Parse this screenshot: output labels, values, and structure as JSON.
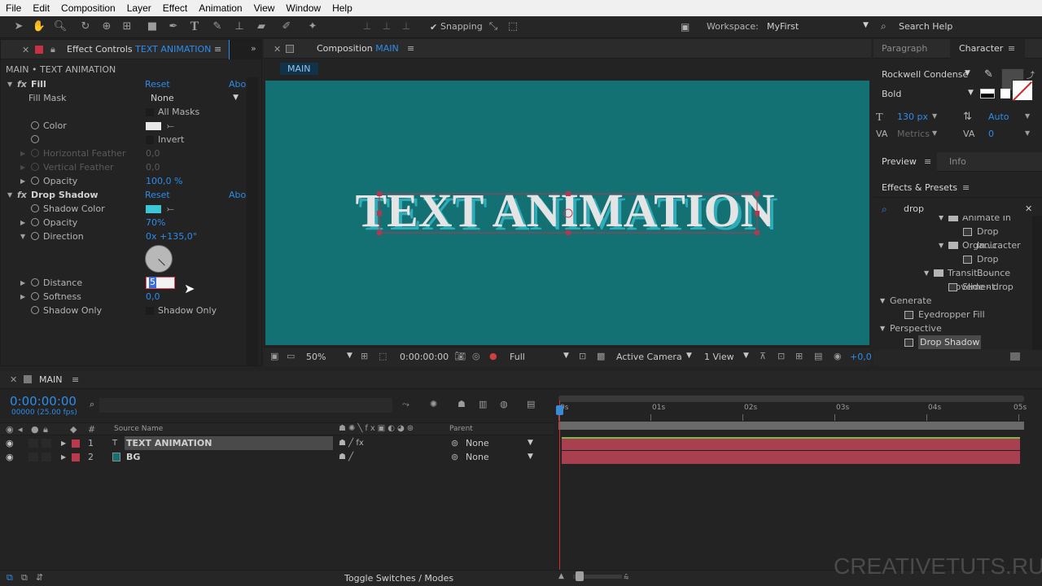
{
  "menu": [
    "File",
    "Edit",
    "Composition",
    "Layer",
    "Effect",
    "Animation",
    "View",
    "Window",
    "Help"
  ],
  "toolbar": {
    "snapping_label": "Snapping",
    "workspace_label": "Workspace:",
    "workspace_value": "MyFirst",
    "search_help": "Search Help"
  },
  "effect_controls": {
    "tab_prefix": "Effect Controls",
    "tab_layer": "TEXT ANIMATION",
    "breadcrumb": "MAIN • TEXT ANIMATION",
    "reset": "Reset",
    "about": "Abo",
    "fill": {
      "name": "Fill",
      "fill_mask_label": "Fill Mask",
      "fill_mask_value": "None",
      "all_masks": "All Masks",
      "color_label": "Color",
      "invert": "Invert",
      "h_feather_label": "Horizontal Feather",
      "h_feather_value": "0,0",
      "v_feather_label": "Vertical Feather",
      "v_feather_value": "0,0",
      "opacity_label": "Opacity",
      "opacity_value": "100,0 %"
    },
    "drop_shadow": {
      "name": "Drop Shadow",
      "shadow_color_label": "Shadow Color",
      "opacity_label": "Opacity",
      "opacity_value": "70%",
      "direction_label": "Direction",
      "direction_value": "0x +135,0°",
      "distance_label": "Distance",
      "distance_value": "5",
      "softness_label": "Softness",
      "softness_value": "0,0",
      "shadow_only_label": "Shadow Only",
      "shadow_only_checkbox": "Shadow Only"
    }
  },
  "composition": {
    "tab_prefix": "Composition",
    "tab_name": "MAIN",
    "comp_chip": "MAIN",
    "canvas_text": "TEXT ANIMATION",
    "zoom": "50%",
    "timecode": "0:00:00:00",
    "resolution": "Full",
    "camera": "Active Camera",
    "views": "1 View",
    "exposure": "+0,0"
  },
  "right_panels": {
    "paragraph_tab": "Paragraph",
    "character_tab": "Character",
    "font": "Rockwell Condense",
    "style": "Bold",
    "size": "130 px",
    "leading": "Auto",
    "kerning": "Metrics",
    "tracking": "0",
    "preview_tab": "Preview",
    "info_tab": "Info",
    "effects_tab": "Effects & Presets",
    "search_value": "drop",
    "tree": [
      {
        "label": "Animate In",
        "indent": 4,
        "type": "folder-open"
      },
      {
        "label": "Drop In...racter",
        "indent": 5,
        "type": "preset"
      },
      {
        "label": "Organic",
        "indent": 4,
        "type": "folder-open"
      },
      {
        "label": "Drop Bounce",
        "indent": 5,
        "type": "preset"
      },
      {
        "label": "Transit... - Movement",
        "indent": 3,
        "type": "folder-open"
      },
      {
        "label": "Slide - drop",
        "indent": 4,
        "type": "preset"
      },
      {
        "label": "Generate",
        "indent": 0,
        "type": "category"
      },
      {
        "label": "Eyedropper Fill",
        "indent": 1,
        "type": "effect"
      },
      {
        "label": "Perspective",
        "indent": 0,
        "type": "category"
      },
      {
        "label": "Drop Shadow",
        "indent": 1,
        "type": "effect-selected"
      }
    ]
  },
  "timeline": {
    "tab": "MAIN",
    "timecode": "0:00:00:00",
    "fps": "00000 (25.00 fps)",
    "col_num": "#",
    "col_source": "Source Name",
    "col_parent": "Parent",
    "ruler": [
      "0s",
      "01s",
      "02s",
      "03s",
      "04s",
      "05s"
    ],
    "layers": [
      {
        "num": "1",
        "name": "TEXT ANIMATION",
        "parent": "None",
        "color": "#b83a4c"
      },
      {
        "num": "2",
        "name": "BG",
        "parent": "None",
        "color": "#b83a4c"
      }
    ],
    "toggle": "Toggle Switches / Modes",
    "watermark": "CREATIVETUTS.RU"
  },
  "colors": {
    "comp_bg": "#137173",
    "text_fill": "#e4e4e4",
    "shadow": "#3dc6d6",
    "accent_blue": "#2d8ceb",
    "layer_bar": "#a8404f"
  }
}
